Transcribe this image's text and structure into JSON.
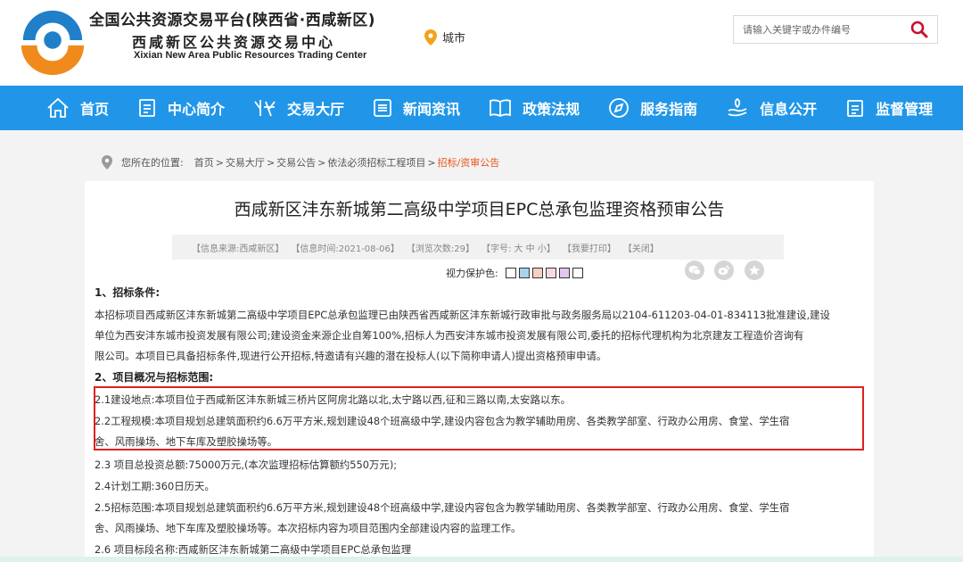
{
  "header": {
    "brand_line1": "全国公共资源交易平台(陕西省·西咸新区)",
    "brand_line2": "西咸新区公共资源交易中心",
    "brand_line3": "Xixian New Area Public Resources Trading Center",
    "city_label": "城市",
    "search_placeholder": "请输入关键字或办件编号"
  },
  "colors": {
    "nav_bg": "#2196e8",
    "highlight_border": "#e02020",
    "crumb_current": "#e8541b",
    "logo_blue": "#1f7fc9",
    "logo_orange": "#f08a1c"
  },
  "nav": {
    "items": [
      {
        "label": "首页",
        "icon": "home-icon"
      },
      {
        "label": "中心简介",
        "icon": "document-icon"
      },
      {
        "label": "交易大厅",
        "icon": "handshake-icon"
      },
      {
        "label": "新闻资讯",
        "icon": "list-icon"
      },
      {
        "label": "政策法规",
        "icon": "book-icon"
      },
      {
        "label": "服务指南",
        "icon": "compass-icon"
      },
      {
        "label": "信息公开",
        "icon": "hand-icon"
      },
      {
        "label": "监督管理",
        "icon": "clipboard-icon"
      }
    ]
  },
  "breadcrumb": {
    "lead": "您所在的位置:",
    "items": [
      "首页",
      "交易大厅",
      "交易公告",
      "依法必须招标工程项目"
    ],
    "current": "招标/资审公告",
    "sep": ">"
  },
  "article": {
    "title": "西咸新区沣东新城第二高级中学项目EPC总承包监理资格预审公告",
    "meta": {
      "source": "【信息来源:西咸新区】",
      "time": "【信息时间:2021-08-06】",
      "views": "【浏览次数:29】",
      "font": "【字号: 大 中 小】",
      "print": "【我要打印】",
      "close": "【关闭】"
    },
    "eye_label": "视力保护色:",
    "eye_colors": [
      "#ffffff",
      "#a8d3ef",
      "#f3cfc4",
      "#f8d8e6",
      "#e2c7ef",
      "#ffffff"
    ],
    "lines": [
      "1、招标条件:",
      "本招标项目西咸新区沣东新城第二高级中学项目EPC总承包监理已由陕西省西咸新区沣东新城行政审批与政务服务局以2104-611203-04-01-834113批准建设,建设",
      "单位为西安沣东城市投资发展有限公司;建设资金来源企业自筹100%,招标人为西安沣东城市投资发展有限公司,委托的招标代理机构为北京建友工程造价咨询有",
      "限公司。本项目已具备招标条件,现进行公开招标,特邀请有兴趣的潜在投标人(以下简称申请人)提出资格预审申请。",
      "2、项目概况与招标范围:",
      "2.1建设地点:本项目位于西咸新区沣东新城三桥片区阿房北路以北,太宁路以西,征和三路以南,太安路以东。",
      "2.2工程规模:本项目规划总建筑面积约6.6万平方米,规划建设48个班高级中学,建设内容包含为教学辅助用房、各类教学部室、行政办公用房、食堂、学生宿",
      "舍、风雨操场、地下车库及塑胶操场等。",
      "2.3 项目总投资总额:75000万元,(本次监理招标估算额约550万元);",
      "2.4计划工期:360日历天。",
      "2.5招标范围:本项目规划总建筑面积约6.6万平方米,规划建设48个班高级中学,建设内容包含为教学辅助用房、各类教学部室、行政办公用房、食堂、学生宿",
      "舍、风雨操场、地下车库及塑胶操场等。本次招标内容为项目范围内全部建设内容的监理工作。",
      "2.6 项目标段名称:西咸新区沣东新城第二高级中学项目EPC总承包监理"
    ]
  }
}
